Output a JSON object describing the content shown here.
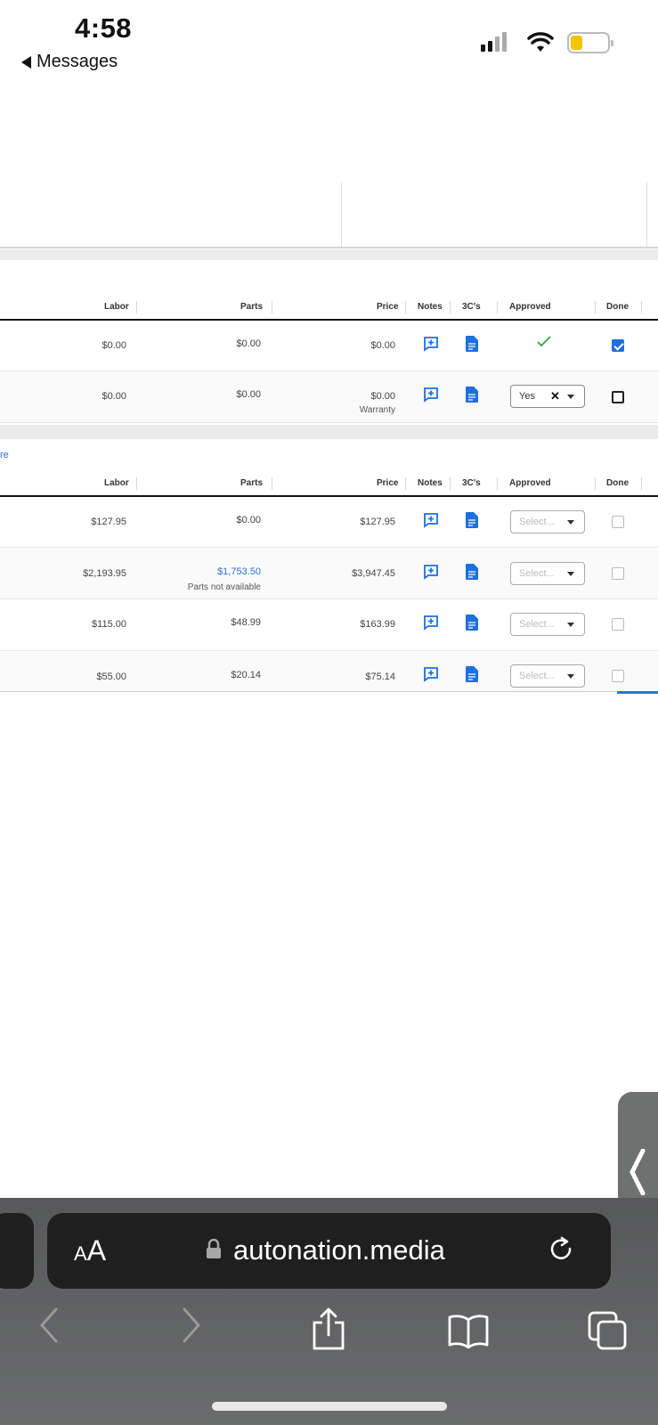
{
  "status_bar": {
    "time": "4:58",
    "back_label": "Messages"
  },
  "colors": {
    "accent_blue": "#2a73d6",
    "approved_green": "#2ea043",
    "battery_yellow": "#f4c400"
  },
  "icons": [
    "back-triangle-icon",
    "signal-icon",
    "wifi-icon",
    "battery-icon",
    "add-note-icon",
    "document-icon",
    "checkmark-icon",
    "caret-down-icon",
    "clear-icon",
    "lock-icon",
    "reload-icon",
    "chevron-left-icon",
    "chevron-right-icon",
    "share-icon",
    "bookmarks-icon",
    "tabs-icon"
  ],
  "table1": {
    "headers": {
      "labor": "Labor",
      "parts": "Parts",
      "price": "Price",
      "notes": "Notes",
      "threec": "3C's",
      "approved": "Approved",
      "done": "Done"
    },
    "rows": [
      {
        "labor": "$0.00",
        "parts": "$0.00",
        "price": "$0.00",
        "approved_state": "check",
        "done": true
      },
      {
        "labor": "$0.00",
        "parts": "$0.00",
        "price": "$0.00",
        "price_note": "Warranty",
        "approved_value": "Yes",
        "done": false
      }
    ]
  },
  "table2": {
    "link_fragment": "re",
    "headers": {
      "labor": "Labor",
      "parts": "Parts",
      "price": "Price",
      "notes": "Notes",
      "threec": "3C's",
      "approved": "Approved",
      "done": "Done"
    },
    "select_placeholder": "Select...",
    "rows": [
      {
        "labor": "$127.95",
        "parts": "$0.00",
        "price": "$127.95",
        "done": false
      },
      {
        "labor": "$2,193.95",
        "parts": "$1,753.50",
        "parts_note": "Parts not available",
        "price": "$3,947.45",
        "done": false
      },
      {
        "labor": "$115.00",
        "parts": "$48.99",
        "price": "$163.99",
        "done": false
      },
      {
        "labor": "$55.00",
        "parts": "$20.14",
        "price": "$75.14",
        "done": false
      }
    ]
  },
  "browser": {
    "text_size_small": "A",
    "text_size_large": "A",
    "domain": "autonation.media"
  }
}
